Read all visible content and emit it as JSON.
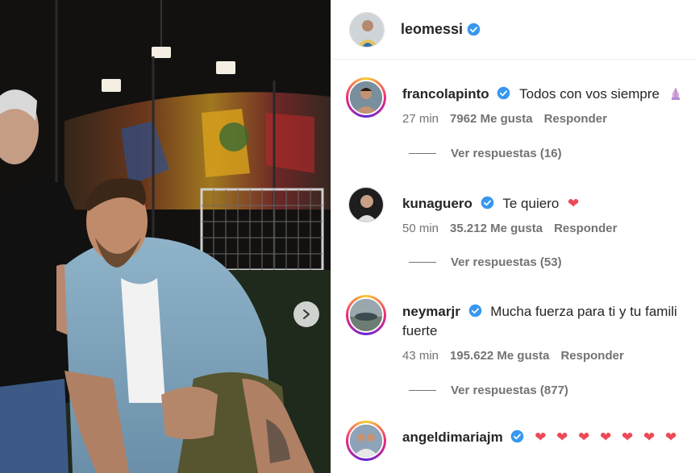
{
  "post": {
    "author": "leomessi",
    "next_arrow_icon": "chevron-right-icon"
  },
  "comments": [
    {
      "username": "francolapinto",
      "text": "Todos con vos siempre",
      "emoji": "praying-hands",
      "time": "27 min",
      "likes": "7962 Me gusta",
      "reply": "Responder",
      "replies": "Ver respuestas (16)"
    },
    {
      "username": "kunaguero",
      "text": "Te quiero",
      "emoji": "❤",
      "time": "50 min",
      "likes": "35.212 Me gusta",
      "reply": "Responder",
      "replies": "Ver respuestas (53)"
    },
    {
      "username": "neymarjr",
      "text": "Mucha fuerza para ti y tu famili",
      "text_line2": "fuerte",
      "time": "43 min",
      "likes": "195.622 Me gusta",
      "reply": "Responder",
      "replies": "Ver respuestas (877)"
    },
    {
      "username": "angeldimariajm",
      "text": "❤ ❤ ❤ ❤ ❤ ❤ ❤"
    }
  ],
  "colors": {
    "verified": "#3897f0",
    "heart": "#ed4956",
    "muted": "#737373",
    "text": "#262626"
  }
}
